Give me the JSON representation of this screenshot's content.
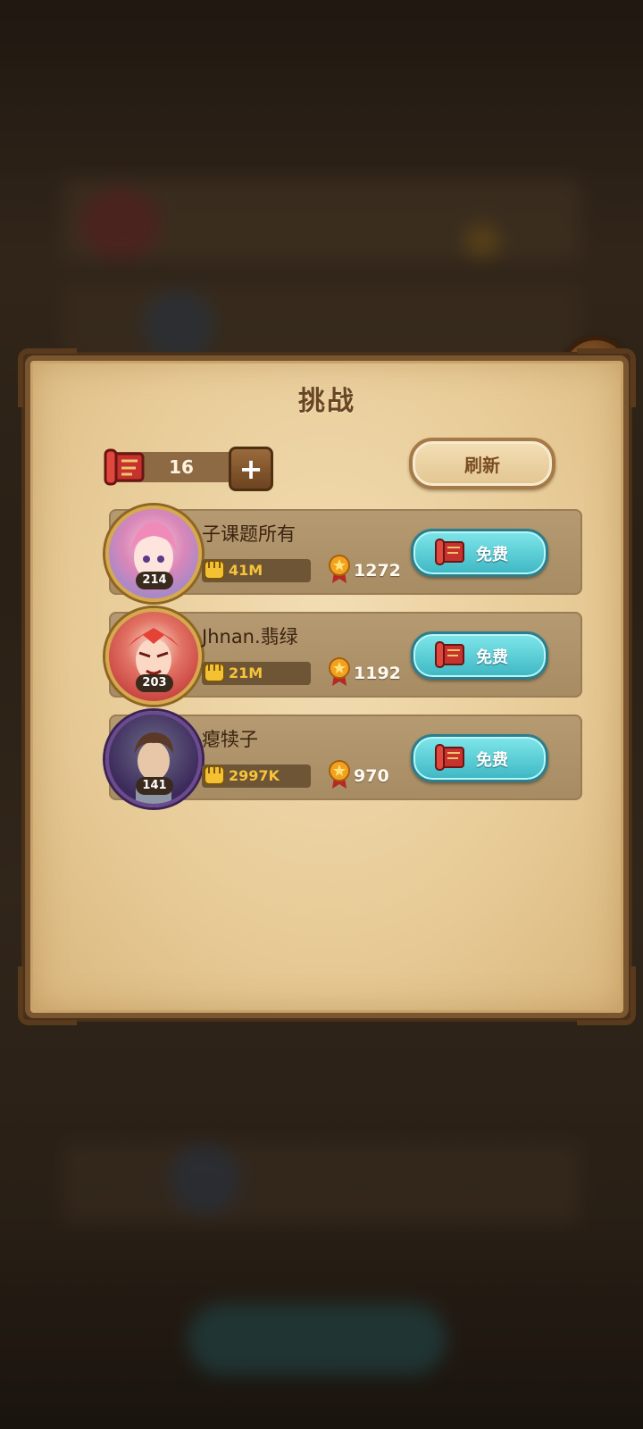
{
  "dialog": {
    "title": "挑战",
    "tickets": {
      "count": "16"
    },
    "refresh_label": "刷新"
  },
  "opponents": [
    {
      "name": "子课题所有",
      "level": "214",
      "power": "41M",
      "score": "1272",
      "free_label": "免费"
    },
    {
      "name": "Jhnan.翡绿",
      "level": "203",
      "power": "21M",
      "score": "1192",
      "free_label": "免费"
    },
    {
      "name": "瘪犊子",
      "level": "141",
      "power": "2997K",
      "score": "970",
      "free_label": "免费"
    }
  ],
  "colors": {
    "gold": "#f7c33b",
    "teal_button": "#3db7c3",
    "parchment": "#e8cc98"
  },
  "icons": {
    "close": "close-icon",
    "ticket": "scroll-ticket-icon",
    "power": "fist-icon",
    "rank": "medal-icon"
  }
}
